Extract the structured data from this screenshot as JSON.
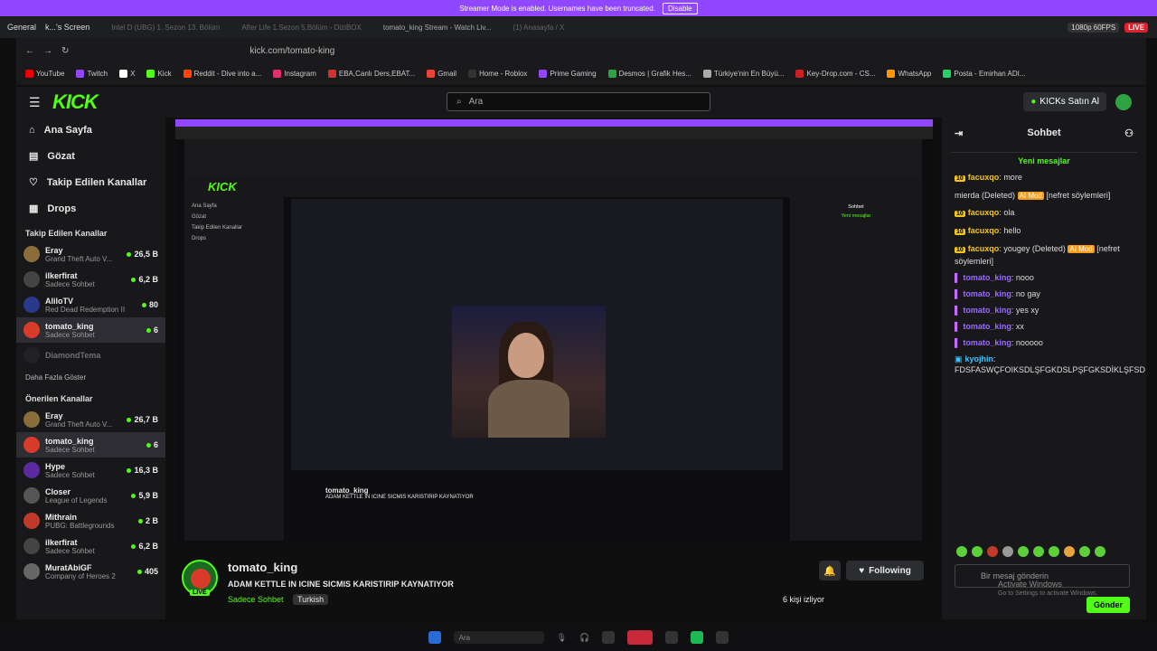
{
  "streamer_bar": {
    "message": "Streamer Mode is enabled. Usernames have been truncated.",
    "disable_label": "Disable"
  },
  "discord": {
    "server": "General",
    "screen": "k...'s Screen",
    "tabs": [
      "Intel D (UBG) 1. Sezon 13. Bölüm",
      "After Life 1.Sezon 5.Bölüm - DiziBOX",
      "tomato_king Stream - Watch Liv...",
      "(1) Anasayfa / X"
    ],
    "quality": "1080p 60FPS",
    "live": "LIVE"
  },
  "browser": {
    "url": "kick.com/tomato-king"
  },
  "bookmarks": [
    "YouTube",
    "Twitch",
    "X",
    "Kick",
    "Reddit - Dive into a...",
    "Instagram",
    "EBA,Canlı Ders,EBAT...",
    "Gmail",
    "Home - Roblox",
    "Prime Gaming",
    "Desmos | Grafik Hes...",
    "Türkiye'nin En Büyü...",
    "Key-Drop.com - CS...",
    "WhatsApp",
    "Posta - Emirhan ADI..."
  ],
  "kick": {
    "logo": "KICK",
    "search_placeholder": "Ara",
    "buy_label": "KICKs Satın Al"
  },
  "nav": {
    "home": "Ana Sayfa",
    "browse": "Gözat",
    "following": "Takip Edilen Kanallar",
    "drops": "Drops"
  },
  "followed_title": "Takip Edilen Kanallar",
  "followed": [
    {
      "name": "Eray",
      "game": "Grand Theft Auto V...",
      "viewers": "26,5 B",
      "color": "#8a6d3b"
    },
    {
      "name": "ilkerfirat",
      "game": "Sadece Sohbet",
      "viewers": "6,2 B",
      "color": "#444"
    },
    {
      "name": "AliloTV",
      "game": "Red Dead Redemption II",
      "viewers": "80",
      "color": "#2a3a8a"
    },
    {
      "name": "tomato_king",
      "game": "Sadece Sohbet",
      "viewers": "6",
      "color": "#d93b2b"
    },
    {
      "name": "DiamondTema",
      "game": "",
      "viewers": "",
      "color": "#333"
    }
  ],
  "show_more": "Daha Fazla Göster",
  "recommended_title": "Önerilen Kanallar",
  "recommended": [
    {
      "name": "Eray",
      "game": "Grand Theft Auto V...",
      "viewers": "26,7 B",
      "color": "#8a6d3b"
    },
    {
      "name": "tomato_king",
      "game": "Sadece Sohbet",
      "viewers": "6",
      "color": "#d93b2b"
    },
    {
      "name": "Hype",
      "game": "Sadece Sohbet",
      "viewers": "16,3 B",
      "color": "#5a2aa0"
    },
    {
      "name": "Closer",
      "game": "League of Legends",
      "viewers": "5,9 B",
      "color": "#555"
    },
    {
      "name": "Mithrain",
      "game": "PUBG: Battlegrounds",
      "viewers": "2 B",
      "color": "#c0392b"
    },
    {
      "name": "ilkerfirat",
      "game": "Sadece Sohbet",
      "viewers": "6,2 B",
      "color": "#444"
    },
    {
      "name": "MuratAbiGF",
      "game": "Company of Heroes 2",
      "viewers": "405",
      "color": "#666"
    }
  ],
  "stream": {
    "name": "tomato_king",
    "title": "ADAM KETTLE IN ICINE SICMIS KARISTIRIP KAYNATIYOR",
    "category": "Sadece Sohbet",
    "language": "Turkish",
    "follow_label": "Following",
    "viewers": "6 kişi izliyor",
    "live": "LIVE"
  },
  "chat": {
    "title": "Sohbet",
    "new_messages": "Yeni mesajlar",
    "messages": [
      {
        "badge": "10",
        "user": "facuxqo",
        "text": ": more",
        "type": "yellow"
      },
      {
        "badge": "",
        "user": "",
        "text": "mierda (Deleted) ",
        "mod": "AI Mod",
        "after": " [nefret söylemleri]",
        "type": "plain"
      },
      {
        "badge": "10",
        "user": "facuxqo",
        "text": ": ola",
        "type": "yellow"
      },
      {
        "badge": "10",
        "user": "facuxqo",
        "text": ": hello",
        "type": "yellow"
      },
      {
        "badge": "10",
        "user": "facuxqo",
        "text": ": yougey (Deleted) ",
        "mod": "AI Mod",
        "after": " [nefret söylemleri]",
        "type": "yellow"
      },
      {
        "badge": "",
        "user": "tomato_king",
        "text": ": nooo",
        "type": "purple"
      },
      {
        "badge": "",
        "user": "tomato_king",
        "text": ": no gay",
        "type": "purple"
      },
      {
        "badge": "",
        "user": "tomato_king",
        "text": ": yes xy",
        "type": "purple"
      },
      {
        "badge": "",
        "user": "tomato_king",
        "text": ": xx",
        "type": "purple"
      },
      {
        "badge": "",
        "user": "tomato_king",
        "text": ": nooooo",
        "type": "purple"
      },
      {
        "badge": "",
        "user": "kyojhin",
        "text": ": FDSFASWÇFOIKSDLŞFGKDSLPŞFGKSDİKLŞFSD",
        "type": "blue"
      }
    ],
    "input_placeholder": "Bir mesaj gönderin",
    "send_label": "Gönder",
    "activate": "Activate Windows",
    "activate_sub": "Go to Settings to activate Windows."
  },
  "taskbar": {
    "search": "Ara"
  }
}
